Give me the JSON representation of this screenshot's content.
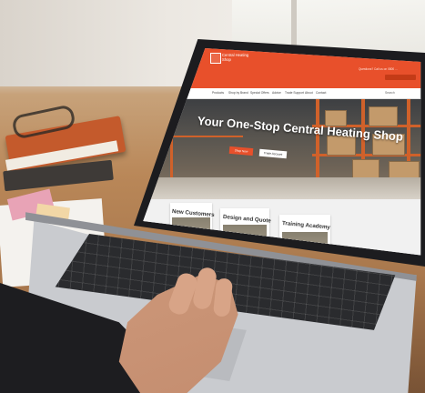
{
  "scene": "laptop-on-desk",
  "website": {
    "header": {
      "logo_line1": "Central Heating",
      "logo_line2": "Shop",
      "info_text": "Questions? Call us on 0800 ...",
      "accent_color": "#e8502b"
    },
    "nav": {
      "items": [
        "Products",
        "Shop by Brand",
        "Special Offers",
        "Advice",
        "Trade Support",
        "About",
        "Contact"
      ],
      "search_label": "Search"
    },
    "hero": {
      "title": "Your One-Stop Central Heating Shop",
      "button_primary": "Shop Now",
      "button_secondary": "Trade Account"
    },
    "cards": [
      {
        "title": "New Customers"
      },
      {
        "title": "Design and Quote"
      },
      {
        "title": "Training Academy"
      }
    ]
  }
}
